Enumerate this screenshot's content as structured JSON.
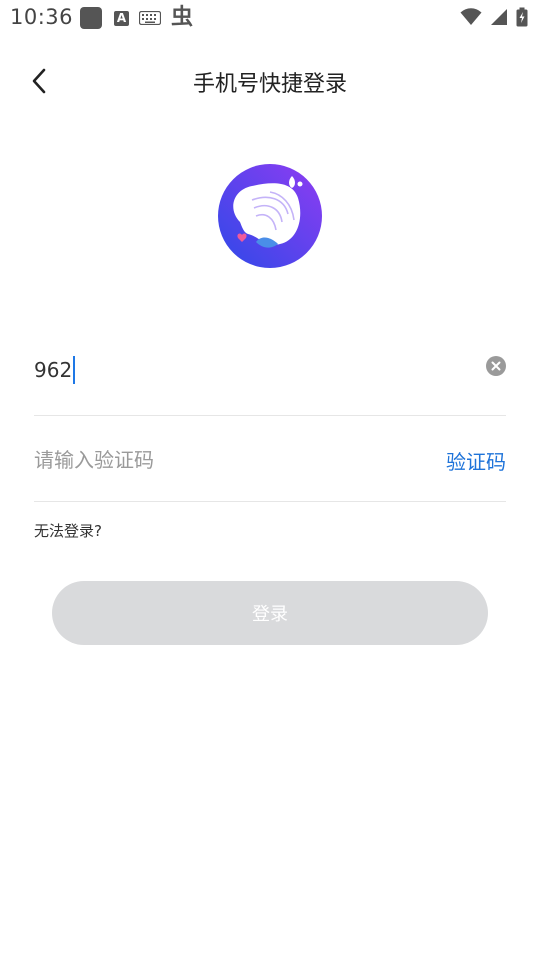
{
  "status_bar": {
    "time": "10:36",
    "left_icons": [
      "app-square-icon",
      "font-a-icon",
      "keyboard-icon",
      "bug-icon"
    ],
    "right_icons": [
      "wifi-icon",
      "cell-signal-icon",
      "battery-charging-icon"
    ],
    "a_glyph": "A",
    "bug_glyph": "虫"
  },
  "header": {
    "title": "手机号快捷登录",
    "back_icon": "chevron-left-icon"
  },
  "logo": {
    "name": "app-logo",
    "colors": {
      "ring_start": "#3a4ee8",
      "ring_end": "#8a3cf0",
      "shell_fill": "#ffffff",
      "heart": "#f05a9a",
      "waves": "#b7a6f7",
      "splash": "#4a8ee8"
    }
  },
  "form": {
    "phone_value": "962",
    "clear_icon": "clear-circle-icon",
    "code_placeholder": "请输入验证码",
    "get_code_label": "验证码"
  },
  "help": {
    "label": "无法登录?"
  },
  "login_button": {
    "label": "登录",
    "bg_color": "#d9dadc",
    "text_color": "#ffffff"
  },
  "colors": {
    "accent": "#1e73d9",
    "caret": "#1e78e6",
    "divider": "#e6e6e6"
  }
}
